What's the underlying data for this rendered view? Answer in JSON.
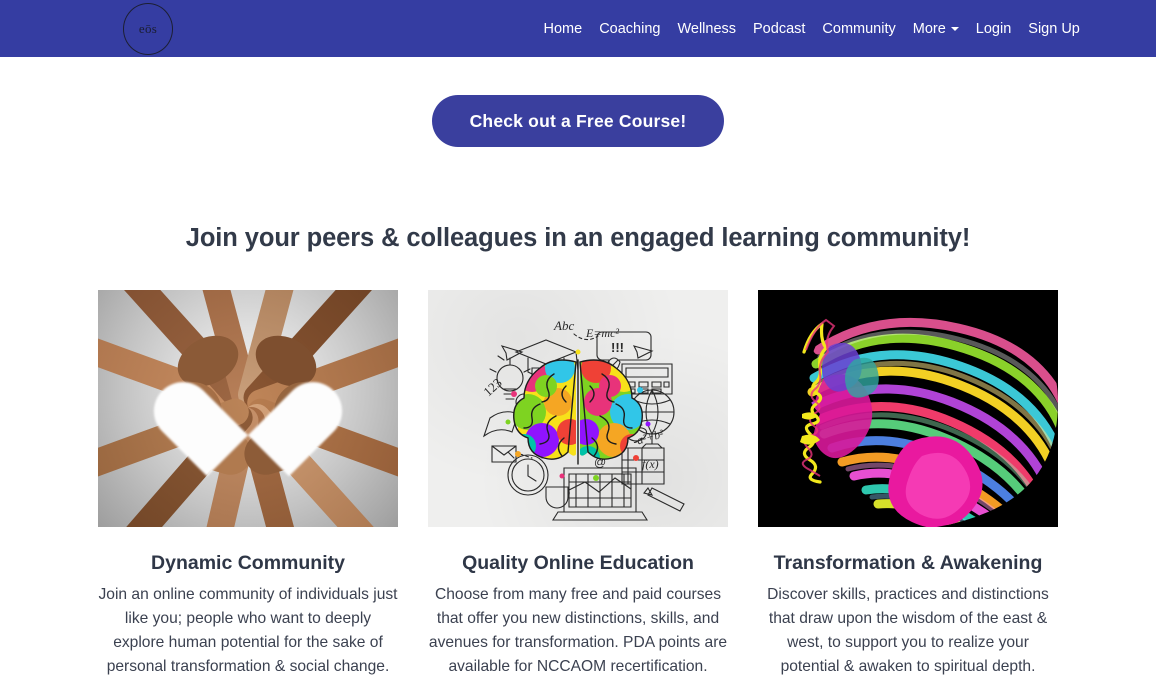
{
  "header": {
    "background_color": "#353da2",
    "logo": {
      "text": "eōs",
      "icon": "circle-logo"
    },
    "nav_items": [
      {
        "label": "Home",
        "name": "nav-home"
      },
      {
        "label": "Coaching",
        "name": "nav-coaching"
      },
      {
        "label": "Wellness",
        "name": "nav-wellness"
      },
      {
        "label": "Podcast",
        "name": "nav-podcast"
      },
      {
        "label": "Community",
        "name": "nav-community"
      },
      {
        "label": "More",
        "name": "nav-more",
        "has_caret": true
      },
      {
        "label": "Login",
        "name": "nav-login"
      },
      {
        "label": "Sign Up",
        "name": "nav-signup"
      }
    ]
  },
  "cta": {
    "label": "Check out a Free Course!",
    "background_color": "#3a3f9e",
    "text_color": "#ffffff"
  },
  "main": {
    "heading": "Join your peers & colleagues in an engaged learning community!",
    "heading_color": "#323a49",
    "cards": [
      {
        "title": "Dynamic Community",
        "body": "Join an online community of individuals just like you; people who want to deeply explore human potential for the sake of personal transformation & social change.",
        "image_alt": "hands-forming-heart-photo"
      },
      {
        "title": "Quality Online Education",
        "body": "Choose from many free and paid courses that offer you new distinctions, skills, and avenues for transformation. PDA points are available for NCCAOM recertification.",
        "image_alt": "colorful-brain-education-doodle"
      },
      {
        "title": "Transformation & Awakening",
        "body": "Discover skills, practices and distinctions that draw upon the wisdom of the east & west, to support you to realize your potential & awaken to spiritual depth.",
        "image_alt": "colorful-face-profile-art"
      }
    ]
  }
}
